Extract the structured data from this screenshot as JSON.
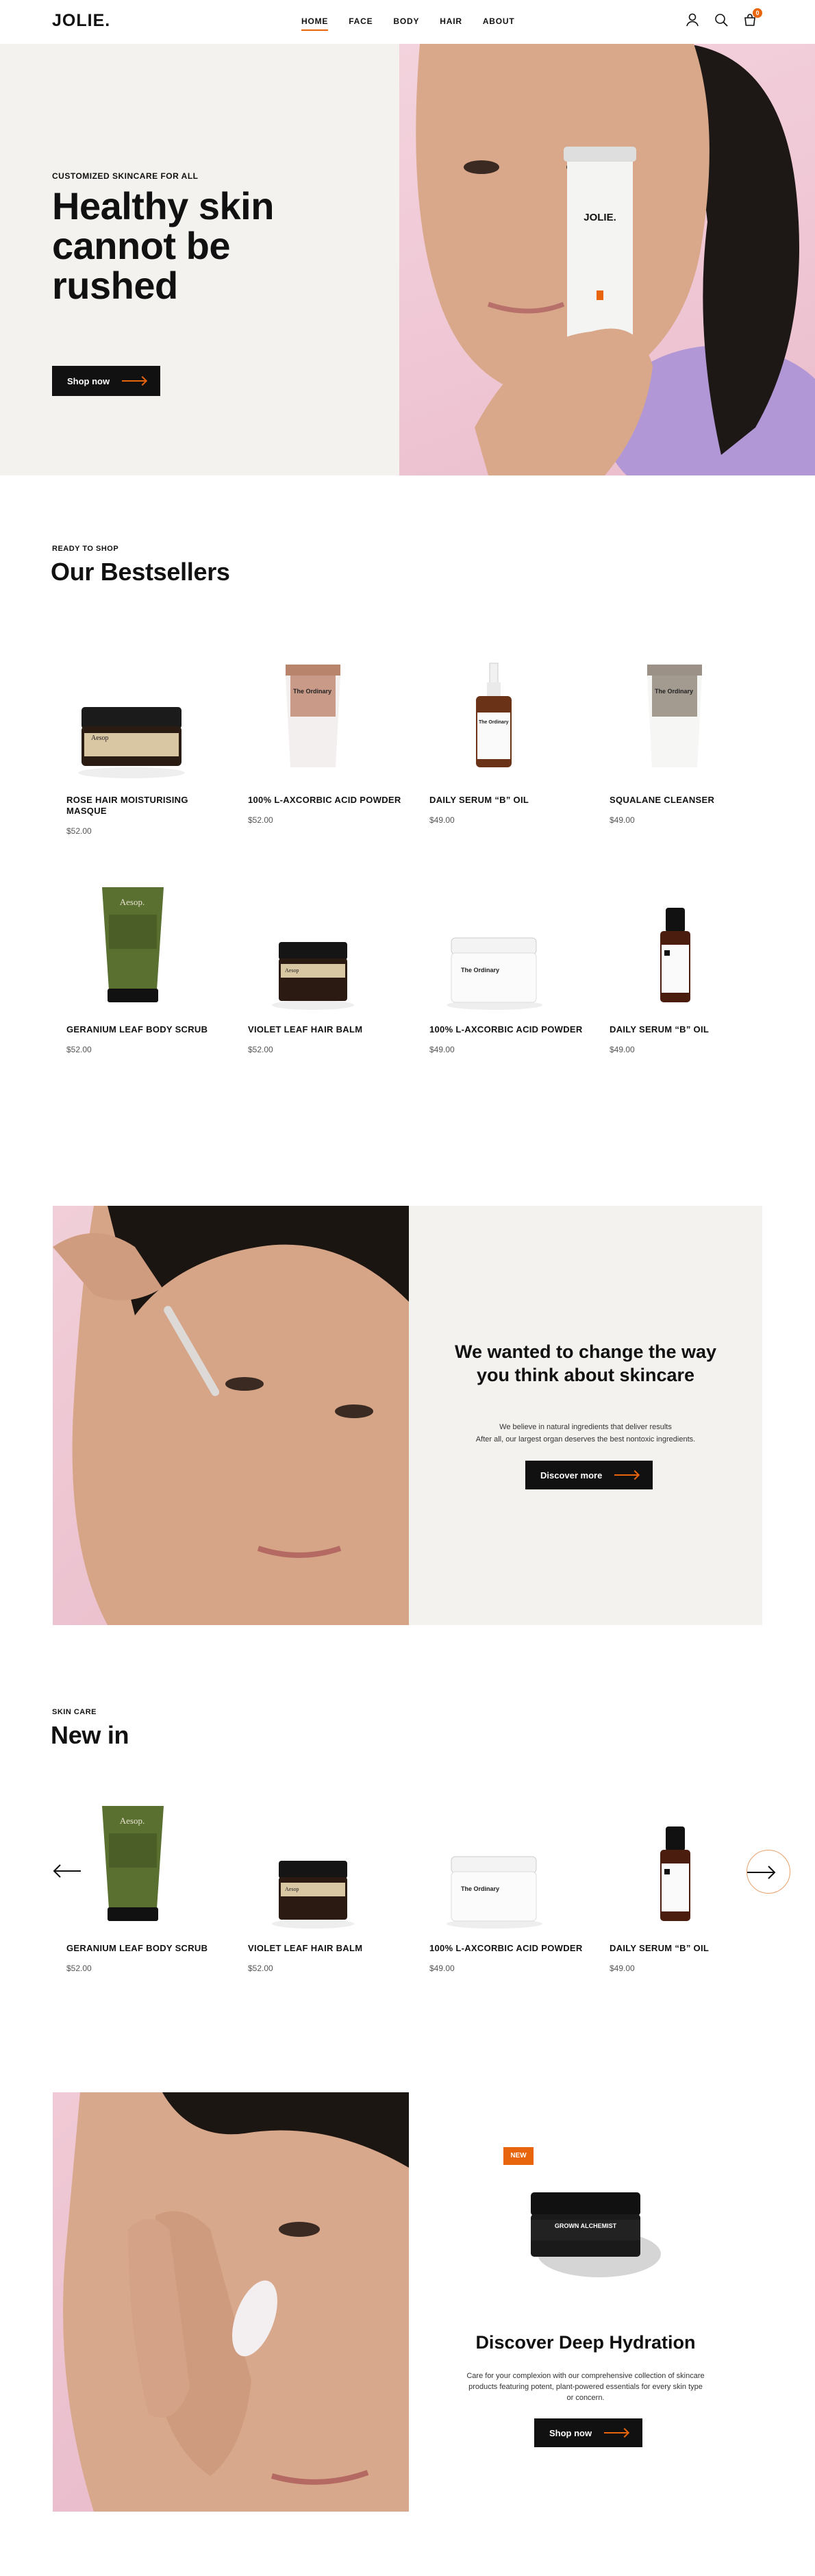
{
  "header": {
    "logo": "JOLIE.",
    "nav": [
      "HOME",
      "FACE",
      "BODY",
      "HAIR",
      "ABOUT"
    ],
    "cart_count": "0"
  },
  "hero": {
    "eyebrow": "CUSTOMIZED SKINCARE FOR ALL",
    "title": "Healthy skin cannot be rushed",
    "cta": "Shop now",
    "tube_label": "JOLIE."
  },
  "bestsellers": {
    "eyebrow": "READY TO SHOP",
    "title": "Our Bestsellers",
    "products": [
      {
        "name": "ROSE HAIR MOISTURISING MASQUE",
        "price": "$52.00",
        "label": "Aesop"
      },
      {
        "name": "100% L-AXCORBIC ACID POWDER",
        "price": "$52.00",
        "label": "The Ordinary"
      },
      {
        "name": "DAILY SERUM “B” OIL",
        "price": "$49.00",
        "label": "The Ordinary"
      },
      {
        "name": "SQUALANE CLEANSER",
        "price": "$49.00",
        "label": "The Ordinary"
      },
      {
        "name": "GERANIUM LEAF BODY SCRUB",
        "price": "$52.00",
        "label": "Aesop."
      },
      {
        "name": "VIOLET LEAF HAIR BALM",
        "price": "$52.00",
        "label": "Aesop"
      },
      {
        "name": "100% L-AXCORBIC ACID POWDER",
        "price": "$49.00",
        "label": "The Ordinary"
      },
      {
        "name": "DAILY SERUM “B” OIL",
        "price": "$49.00",
        "label": ""
      }
    ]
  },
  "promo": {
    "title": "We wanted to change the way you think about skincare",
    "text_line1": "We believe in natural ingredients that deliver results",
    "text_line2": "After all, our largest organ deserves the best nontoxic ingredients.",
    "cta": "Discover more"
  },
  "new_in": {
    "eyebrow": "SKIN CARE",
    "title": "New in",
    "products": [
      {
        "name": "GERANIUM LEAF BODY SCRUB",
        "price": "$52.00",
        "label": "Aesop."
      },
      {
        "name": "VIOLET LEAF HAIR BALM",
        "price": "$52.00",
        "label": "Aesop"
      },
      {
        "name": "100% L-AXCORBIC ACID POWDER",
        "price": "$49.00",
        "label": "The Ordinary"
      },
      {
        "name": "DAILY SERUM “B” OIL",
        "price": "$49.00",
        "label": ""
      }
    ]
  },
  "feature": {
    "badge": "NEW",
    "jar_label": "GROWN ALCHEMIST",
    "title": "Discover Deep Hydration",
    "text": "Care for your complexion with our comprehensive collection of skincare products featuring potent, plant-powered essentials for every skin type or concern.",
    "cta": "Shop now"
  },
  "colors": {
    "accent": "#e8650e",
    "dark": "#111111",
    "panel": "#f3f2ef",
    "pink": "#efc6d4"
  }
}
